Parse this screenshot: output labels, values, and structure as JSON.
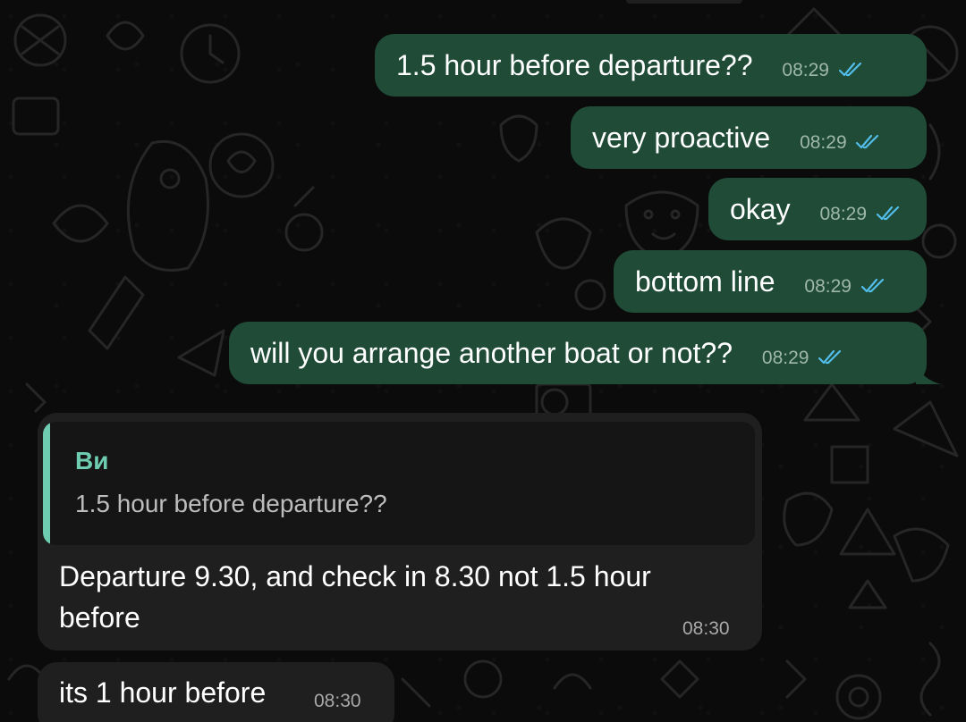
{
  "conversation": {
    "outgoing": [
      {
        "text": "1.5 hour before departure??",
        "time": "08:29",
        "status_icon": "read-double-check-icon"
      },
      {
        "text": "very proactive",
        "time": "08:29",
        "status_icon": "read-double-check-icon"
      },
      {
        "text": "okay",
        "time": "08:29",
        "status_icon": "read-double-check-icon"
      },
      {
        "text": "bottom line",
        "time": "08:29",
        "status_icon": "read-double-check-icon"
      },
      {
        "text": "will you arrange another boat or not??",
        "time": "08:29",
        "status_icon": "read-double-check-icon"
      }
    ],
    "incoming": [
      {
        "reply_to": {
          "author": "Ви",
          "text": "1.5 hour before departure??"
        },
        "text_line1": "Departure 9.30, and check in 8.30 not 1.5 hour",
        "text_line2": "before",
        "time": "08:30"
      },
      {
        "text": "its 1 hour before",
        "time": "08:30"
      }
    ]
  },
  "colors": {
    "background": "#0b0b0b",
    "outgoing_bubble": "#1f4b37",
    "incoming_bubble": "#1f1f1f",
    "reply_accent": "#6ecdb0",
    "read_ticks": "#53bdeb"
  }
}
